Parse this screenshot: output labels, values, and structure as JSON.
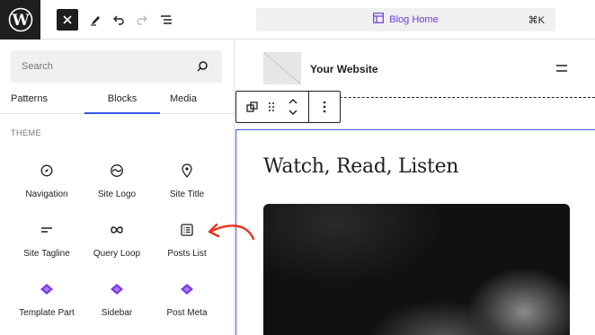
{
  "topbar": {
    "logo_icon": "wordpress-logo-icon",
    "close_icon": "close-icon",
    "pen_icon": "pen-icon",
    "undo_icon": "undo-icon",
    "redo_icon": "redo-icon",
    "document_overview_icon": "list-view-icon",
    "command": {
      "title": "Blog Home",
      "shortcut": "⌘K",
      "icon": "layout-icon"
    }
  },
  "sidebar": {
    "search": {
      "placeholder": "Search"
    },
    "tabs": [
      {
        "label": "Patterns"
      },
      {
        "label": "Blocks",
        "active": true
      },
      {
        "label": "Media"
      }
    ],
    "section_title": "THEME",
    "blocks": [
      {
        "label": "Navigation",
        "icon": "navigation-icon"
      },
      {
        "label": "Site Logo",
        "icon": "site-logo-icon"
      },
      {
        "label": "Site Title",
        "icon": "map-marker-icon"
      },
      {
        "label": "Site Tagline",
        "icon": "tagline-icon"
      },
      {
        "label": "Query Loop",
        "icon": "loop-icon"
      },
      {
        "label": "Posts List",
        "icon": "posts-list-icon"
      },
      {
        "label": "Template Part",
        "icon": "template-part-icon"
      },
      {
        "label": "Sidebar",
        "icon": "template-part-icon"
      },
      {
        "label": "Post Meta",
        "icon": "template-part-icon"
      }
    ]
  },
  "canvas": {
    "site_title": "Your Website",
    "heading": "Watch, Read, Listen"
  },
  "colors": {
    "accent_purple": "#6b3dd6",
    "arrow_red": "#e5341f",
    "selection_blue": "#3858e9"
  }
}
